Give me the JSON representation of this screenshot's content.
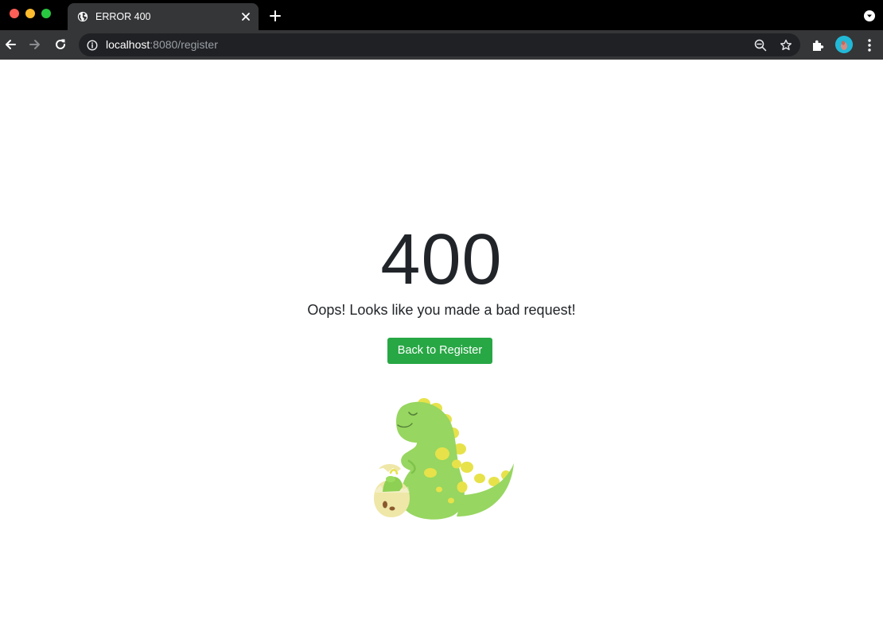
{
  "browser": {
    "tab": {
      "title": "ERROR 400"
    },
    "address": {
      "host": "localhost",
      "rest": ":8080/register"
    }
  },
  "page": {
    "error_code": "400",
    "message": "Oops! Looks like you made a bad request!",
    "back_button_label": "Back to Register",
    "colors": {
      "button": "#28a745",
      "dino_body": "#97d660",
      "dino_spots": "#e7e24a",
      "egg": "#efe7a8"
    },
    "illustration": "dinosaur-with-hatching-egg"
  }
}
